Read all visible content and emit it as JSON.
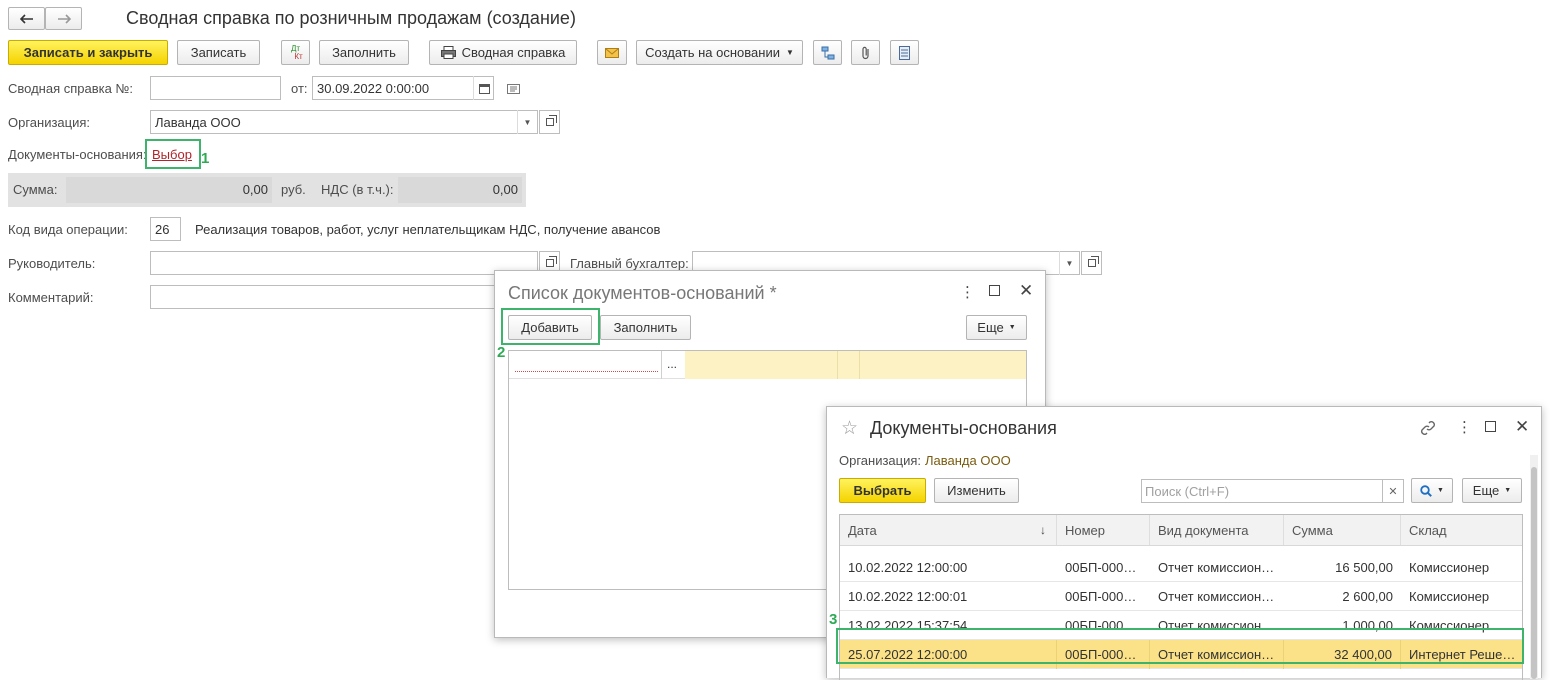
{
  "header": {
    "back_icon": "arrow-left-icon",
    "forward_icon": "arrow-right-icon",
    "title": "Сводная справка по розничным продажам (создание)"
  },
  "toolbar": {
    "save_close": "Записать и закрыть",
    "save": "Записать",
    "dtkt_top": "Дт",
    "dtkt_bottom": "Кт",
    "fill": "Заполнить",
    "summary_ref": "Сводная справка",
    "create_based_on": "Создать на основании"
  },
  "form": {
    "number_label": "Сводная справка №:",
    "number_value": "",
    "date_label": "от:",
    "date_value": "30.09.2022  0:00:00",
    "org_label": "Организация:",
    "org_value": "Лаванда ООО",
    "base_docs_label": "Документы-основания:",
    "base_docs_link": "Выбор",
    "sum_label": "Сумма:",
    "sum_value": "0,00",
    "currency": "руб.",
    "vat_label": "НДС (в т.ч.):",
    "vat_value": "0,00",
    "op_code_label": "Код вида операции:",
    "op_code_value": "26",
    "op_code_desc": "Реализация товаров, работ, услуг неплательщикам НДС, получение авансов",
    "head_label": "Руководитель:",
    "chief_acc_label": "Главный бухгалтер:",
    "comment_label": "Комментарий:"
  },
  "markers": {
    "m1": "1",
    "m2": "2",
    "m3": "3"
  },
  "list_dialog": {
    "title": "Список документов-оснований *",
    "add": "Добавить",
    "fill": "Заполнить",
    "more": "Еще",
    "row_ellipsis": "..."
  },
  "select_dialog": {
    "title": "Документы-основания",
    "org_label": "Организация:",
    "org_value": "Лаванда ООО",
    "choose": "Выбрать",
    "edit": "Изменить",
    "search_placeholder": "Поиск (Ctrl+F)",
    "more": "Еще",
    "columns": [
      "Дата",
      "Номер",
      "Вид документа",
      "Сумма",
      "Склад"
    ],
    "rows": [
      {
        "date": "10.02.2022 12:00:00",
        "number": "00БП-000…",
        "type": "Отчет комиссион…",
        "sum": "16 500,00",
        "store": "Комиссионер"
      },
      {
        "date": "10.02.2022 12:00:01",
        "number": "00БП-000…",
        "type": "Отчет комиссион…",
        "sum": "2 600,00",
        "store": "Комиссионер"
      },
      {
        "date": "13.02.2022 15:37:54",
        "number": "00БП-000…",
        "type": "Отчет комиссион…",
        "sum": "1 000,00",
        "store": "Комиссионер"
      },
      {
        "date": "25.07.2022 12:00:00",
        "number": "00БП-000…",
        "type": "Отчет комиссион…",
        "sum": "32 400,00",
        "store": "Интернет Реше…"
      }
    ],
    "selected_row": 3
  },
  "colors": {
    "accent": "#f5d300",
    "highlight": "#3db36b",
    "selected_row": "#fbe288",
    "link": "#b0252b"
  }
}
